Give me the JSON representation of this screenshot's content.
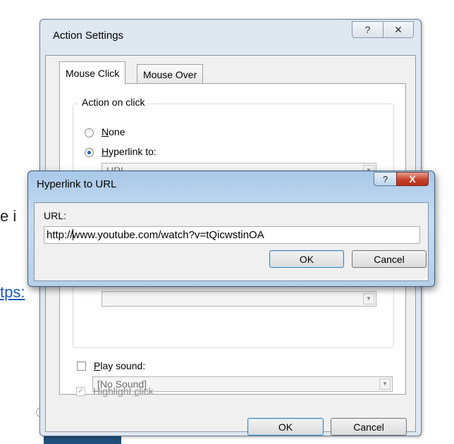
{
  "background": {
    "fragment_1": "e i",
    "fragment_2": "tps:"
  },
  "action_settings": {
    "title": "Action Settings",
    "caption_help": "?",
    "caption_close": "✕",
    "tabs": [
      {
        "label": "Mouse Click",
        "active": true
      },
      {
        "label": "Mouse Over",
        "active": false
      }
    ],
    "group_label": "Action on click",
    "options": {
      "none": {
        "prefix": "",
        "accel": "N",
        "rest": "one",
        "checked": false
      },
      "hyperlink": {
        "accel": "H",
        "rest": "yperlink to:",
        "checked": true
      }
    },
    "hyperlink_value": "URL",
    "play_sound": {
      "accel": "P",
      "rest": "lay sound:",
      "checked": false
    },
    "sound_value": "[No Sound]",
    "highlight": {
      "prefix": "Highlight ",
      "accel": "c",
      "rest": "lick",
      "checked": true
    },
    "ok_label": "OK",
    "cancel_label": "Cancel"
  },
  "hyperlink_dialog": {
    "title": "Hyperlink to URL",
    "caption_help": "?",
    "caption_close": "X",
    "url_label": "URL:",
    "url_before_caret": "http://",
    "url_after_caret": "www.youtube.com/watch?v=tQicwstinOA",
    "ok_label": "OK",
    "cancel_label": "Cancel"
  },
  "colors": {
    "link": "#1b58b8",
    "close_button": "#c7402a",
    "radio_dot": "#1d5fbf"
  }
}
